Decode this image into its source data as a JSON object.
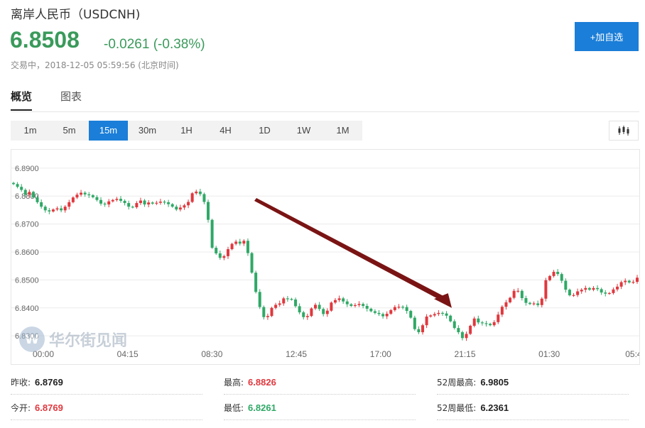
{
  "header": {
    "title": "离岸人民币（USDCNH)",
    "price": "6.8508",
    "change": "-0.0261 (-0.38%)",
    "status": "交易中，2018-12-05 05:59:56 (北京时间)",
    "add_label": "+加自选"
  },
  "tabs": [
    {
      "label": "概览"
    },
    {
      "label": "图表"
    }
  ],
  "periods": [
    {
      "label": "1m"
    },
    {
      "label": "5m"
    },
    {
      "label": "15m"
    },
    {
      "label": "30m"
    },
    {
      "label": "1H"
    },
    {
      "label": "4H"
    },
    {
      "label": "1D"
    },
    {
      "label": "1W"
    },
    {
      "label": "1M"
    }
  ],
  "active_period": "15m",
  "chart_type_icon": "candlestick-icon",
  "watermark": {
    "logo": "W",
    "text": "华尔街见闻"
  },
  "stats": {
    "prev_close_label": "昨收:",
    "prev_close": "6.8769",
    "open_label": "今开:",
    "open": "6.8769",
    "high_label": "最高:",
    "high": "6.8826",
    "low_label": "最低:",
    "low": "6.8261",
    "high52_label": "52周最高:",
    "high52": "6.9805",
    "low52_label": "52周最低:",
    "low52": "6.2361"
  },
  "colors": {
    "up": "#e0383e",
    "down": "#2fa866",
    "accent": "#1b7ed8",
    "arrow": "#7a1414"
  },
  "chart_data": {
    "type": "candlestick",
    "yticks": [
      "6.8900",
      "6.8800",
      "6.8700",
      "6.8600",
      "6.8500",
      "6.8400",
      "6.8300"
    ],
    "xticks": [
      "00:00",
      "04:15",
      "08:30",
      "12:45",
      "17:00",
      "21:15",
      "01:30",
      "05:4"
    ],
    "ylim": [
      6.8275,
      6.8925
    ],
    "closes": [
      6.8843,
      6.8833,
      6.8822,
      6.8805,
      6.8815,
      6.8795,
      6.8778,
      6.8762,
      6.8749,
      6.8745,
      6.8752,
      6.8756,
      6.8749,
      6.8762,
      6.8778,
      6.8795,
      6.8805,
      6.8812,
      6.8806,
      6.8803,
      6.8796,
      6.8786,
      6.8773,
      6.877,
      6.8781,
      6.8786,
      6.879,
      6.8783,
      6.8775,
      6.8762,
      6.876,
      6.8775,
      6.8784,
      6.877,
      6.8777,
      6.8773,
      6.8776,
      6.878,
      6.8778,
      6.8771,
      6.8762,
      6.8752,
      6.8759,
      6.8767,
      6.8779,
      6.881,
      6.8816,
      6.8807,
      6.8779,
      6.8715,
      6.8615,
      6.8595,
      6.8579,
      6.8585,
      6.861,
      6.8629,
      6.8637,
      6.863,
      6.864,
      6.8596,
      6.8526,
      6.8457,
      6.8403,
      6.8367,
      6.8371,
      6.84,
      6.8411,
      6.8416,
      6.8434,
      6.8432,
      6.843,
      6.8406,
      6.8384,
      6.8367,
      6.8371,
      6.8398,
      6.8411,
      6.8396,
      6.8378,
      6.839,
      6.8419,
      6.8428,
      6.8434,
      6.8423,
      6.8413,
      6.8407,
      6.841,
      6.8414,
      6.8407,
      6.8397,
      6.8388,
      6.8382,
      6.8378,
      6.837,
      6.8379,
      6.8392,
      6.8403,
      6.8404,
      6.8403,
      6.8389,
      6.8365,
      6.8324,
      6.8313,
      6.8338,
      6.8369,
      6.8373,
      6.8378,
      6.8382,
      6.838,
      6.8372,
      6.8352,
      6.8328,
      6.8313,
      6.8292,
      6.8307,
      6.8336,
      6.8362,
      6.8348,
      6.8345,
      6.8343,
      6.8338,
      6.8349,
      6.8376,
      6.8404,
      6.842,
      6.8436,
      6.8461,
      6.8461,
      6.8435,
      6.8418,
      6.8414,
      6.8416,
      6.841,
      6.8433,
      6.8499,
      6.8514,
      6.8529,
      6.8521,
      6.8497,
      6.8465,
      6.8445,
      6.8446,
      6.8459,
      6.8465,
      6.8471,
      6.8465,
      6.8471,
      6.8467,
      6.8455,
      6.8451,
      6.8453,
      6.8466,
      6.8476,
      6.8492,
      6.8497,
      6.8491,
      6.8493,
      6.8508
    ]
  }
}
